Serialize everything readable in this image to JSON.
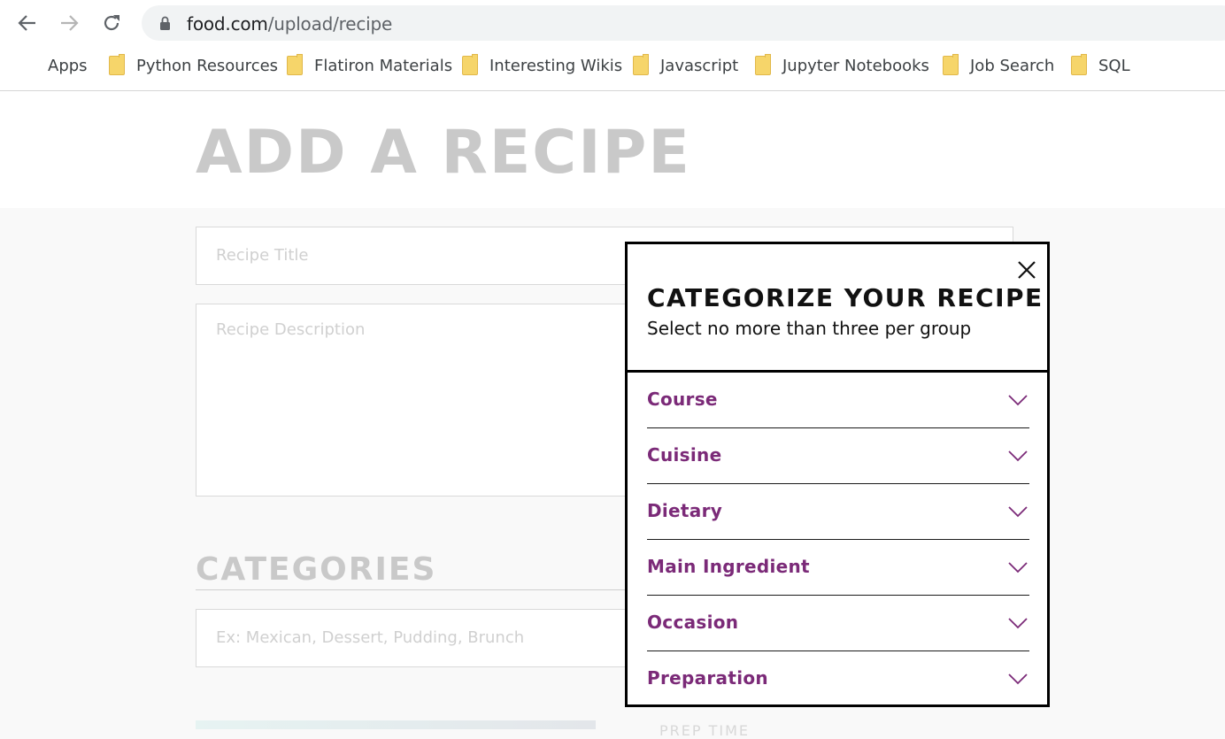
{
  "browser": {
    "url_host": "food.com",
    "url_path": "/upload/recipe",
    "bookmarks": [
      {
        "label": "Apps",
        "icon": "apps-grid-icon"
      },
      {
        "label": "Python Resources",
        "icon": "folder-icon"
      },
      {
        "label": "Flatiron Materials",
        "icon": "folder-icon"
      },
      {
        "label": "Interesting Wikis",
        "icon": "folder-icon"
      },
      {
        "label": "Javascript",
        "icon": "folder-icon"
      },
      {
        "label": "Jupyter Notebooks",
        "icon": "folder-icon"
      },
      {
        "label": "Job Search",
        "icon": "folder-icon"
      },
      {
        "label": "SQL",
        "icon": "folder-icon"
      }
    ]
  },
  "page": {
    "title": "ADD A RECIPE",
    "recipe_title_placeholder": "Recipe Title",
    "recipe_description_placeholder": "Recipe Description",
    "categories_heading": "CATEGORIES",
    "categories_placeholder": "Ex: Mexican, Dessert, Pudding, Brunch",
    "prep_time_label": "PREP TIME"
  },
  "modal": {
    "title": "CATEGORIZE YOUR RECIPE",
    "subtitle": "Select no more than three per group",
    "groups": [
      {
        "label": "Course"
      },
      {
        "label": "Cuisine"
      },
      {
        "label": "Dietary"
      },
      {
        "label": "Main Ingredient"
      },
      {
        "label": "Occasion"
      },
      {
        "label": "Preparation"
      }
    ]
  },
  "colors": {
    "accent_purple": "#7b2a78",
    "heading_gray": "#c9c9c9",
    "folder_yellow": "#f6d56a"
  }
}
